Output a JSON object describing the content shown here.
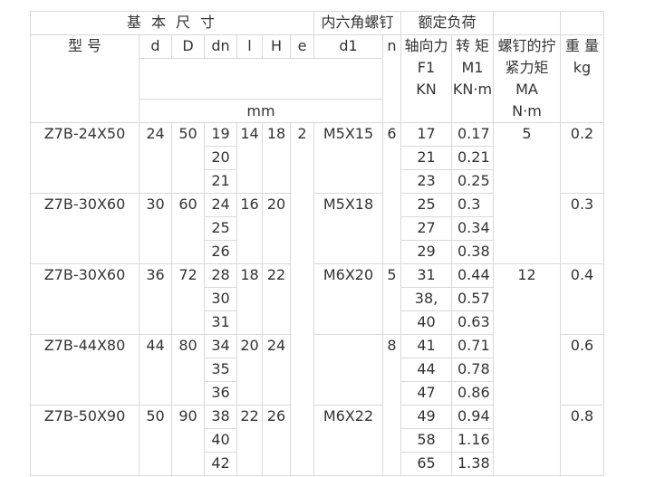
{
  "header": {
    "basic_dims": "基 本 尺 寸",
    "hex_screw": "内六角螺钉",
    "rated_load": "额定负荷",
    "model": "型 号",
    "d": "d",
    "D": "D",
    "dn": "dn",
    "l": "l",
    "H": "H",
    "e": "e",
    "d1": "d1",
    "n": "n",
    "axial_force": "轴向力",
    "axial_symbol": "F1",
    "axial_unit": "KN",
    "torque": "转 矩",
    "torque_symbol": "M1",
    "torque_unit": "KN·m",
    "tight_torque_l1": "螺钉的拧",
    "tight_torque_l2": "紧力矩",
    "tight_torque_symbol": "MA",
    "tight_torque_unit": "N·m",
    "weight": "重 量",
    "weight_unit": "kg",
    "mm_unit": "mm"
  },
  "groups": [
    {
      "model": "Z7B-24X50",
      "d": "24",
      "D": "50",
      "l": "14",
      "H": "18",
      "d1": "M5X15",
      "weight": "0.2",
      "rows": [
        {
          "dn": "19",
          "f1": "17",
          "m1": "0.17"
        },
        {
          "dn": "20",
          "f1": "21",
          "m1": "0.21"
        },
        {
          "dn": "21",
          "f1": "23",
          "m1": "0.25"
        }
      ]
    },
    {
      "model": "Z7B-30X60",
      "d": "30",
      "D": "60",
      "l": "16",
      "H": "20",
      "d1": "M5X18",
      "weight": "0.3",
      "rows": [
        {
          "dn": "24",
          "f1": "25",
          "m1": "0.3"
        },
        {
          "dn": "25",
          "f1": "27",
          "m1": "0.34"
        },
        {
          "dn": "26",
          "f1": "29",
          "m1": "0.38"
        }
      ]
    },
    {
      "model": "Z7B-30X60",
      "d": "36",
      "D": "72",
      "l": "18",
      "H": "22",
      "d1": "M6X20",
      "weight": "0.4",
      "rows": [
        {
          "dn": "28",
          "f1": "31",
          "m1": "0.44"
        },
        {
          "dn": "30",
          "f1": "38,",
          "m1": "0.57"
        },
        {
          "dn": "31",
          "f1": "40",
          "m1": "0.63"
        }
      ]
    },
    {
      "model": "Z7B-44X80",
      "d": "44",
      "D": "80",
      "l": "20",
      "H": "24",
      "d1": "",
      "weight": "0.6",
      "rows": [
        {
          "dn": "34",
          "f1": "41",
          "m1": "0.71"
        },
        {
          "dn": "35",
          "f1": "44",
          "m1": "0.78"
        },
        {
          "dn": "36",
          "f1": "47",
          "m1": "0.86"
        }
      ]
    },
    {
      "model": "Z7B-50X90",
      "d": "50",
      "D": "90",
      "l": "22",
      "H": "26",
      "d1": "M6X22",
      "weight": "0.8",
      "rows": [
        {
          "dn": "38",
          "f1": "49",
          "m1": "0.94"
        },
        {
          "dn": "40",
          "f1": "58",
          "m1": "1.16"
        },
        {
          "dn": "42",
          "f1": "65",
          "m1": "1.38"
        }
      ]
    }
  ],
  "merged": {
    "e_value": "2",
    "n_values": [
      "6",
      "5",
      "8"
    ],
    "ma_values": [
      "5",
      "12"
    ]
  }
}
